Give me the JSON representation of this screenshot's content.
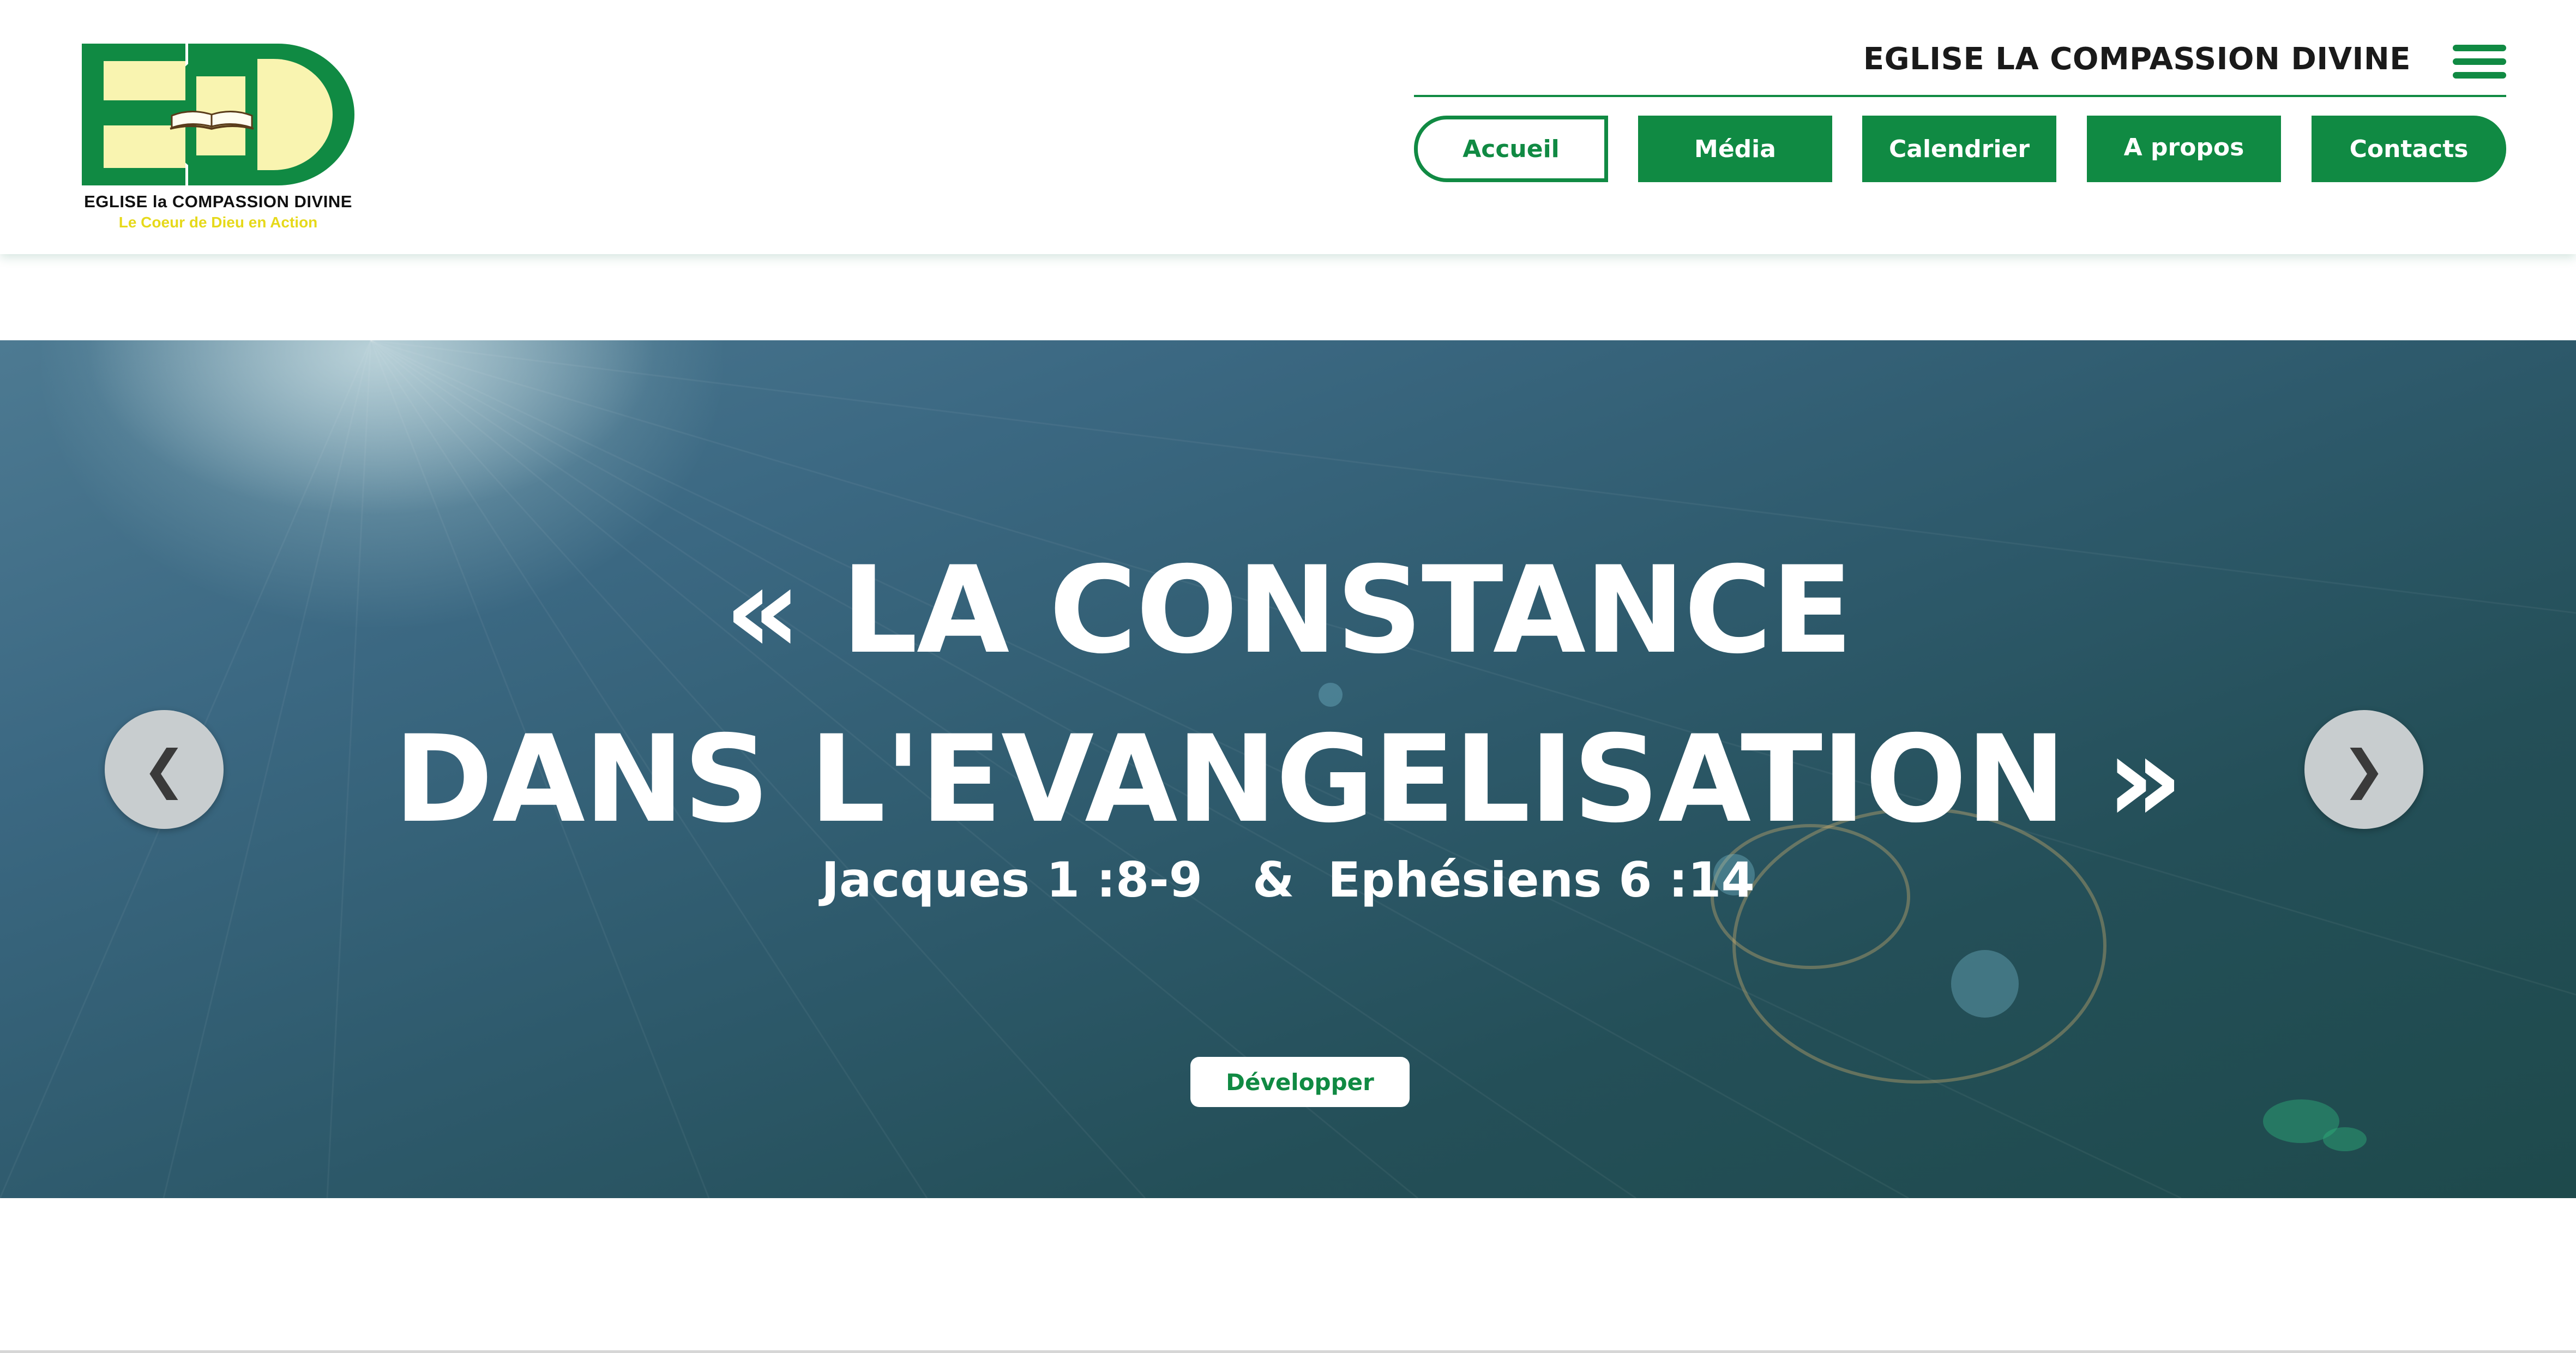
{
  "header": {
    "logo": {
      "letters": "ECD",
      "line1": "EGLISE la COMPASSION DIVINE",
      "line2": "Le Coeur de Dieu en Action"
    },
    "church_title": "EGLISE LA COMPASSION DIVINE",
    "menu_icon": "hamburger-menu-icon",
    "nav": [
      {
        "label": "Accueil",
        "active": true
      },
      {
        "label": "Média"
      },
      {
        "label": "Calendrier"
      },
      {
        "label": "A propos"
      },
      {
        "label": "Contacts"
      }
    ]
  },
  "hero": {
    "title_line1": "« LA CONSTANCE",
    "title_line2": "DANS L'EVANGELISATION »",
    "reference": "Jacques 1 :8-9   &  Ephésiens 6 :14",
    "button_label": "Développer",
    "prev_arrow": "❮",
    "next_arrow": "❯"
  },
  "colors": {
    "brand_green": "#108a43",
    "logo_yellow": "#f9f4b0",
    "tagline_yellow": "#e6d91a"
  }
}
